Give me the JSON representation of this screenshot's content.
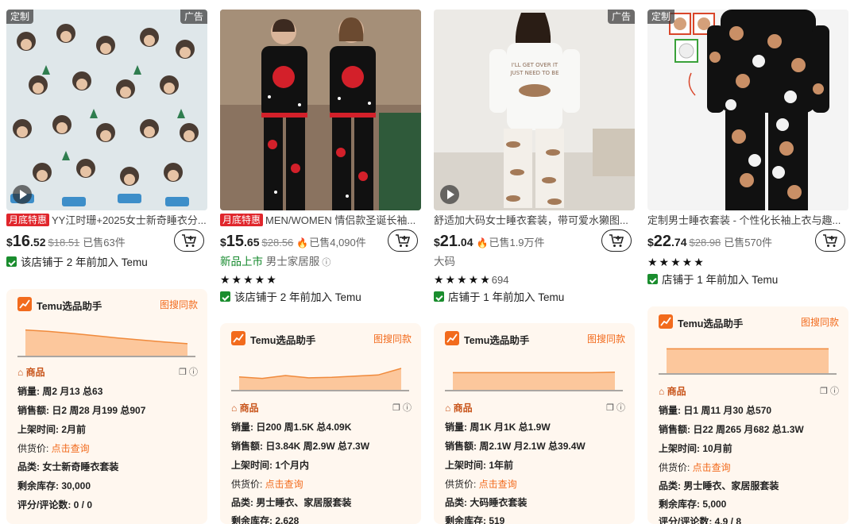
{
  "products": [
    {
      "badge_left": "定制",
      "badge_right": "广告",
      "video": true,
      "promo": "月底特惠",
      "title": "YY江时珊+2025女士新奇睡衣分...",
      "price_currency": "$",
      "price_int": "16",
      "price_cents": ".52",
      "orig_price": "$18.51",
      "hot": false,
      "sold": "已售63件",
      "new_tag": "",
      "category_tag": "",
      "size_tag": "",
      "stars": "",
      "rating_count": "",
      "store": "该店铺于 2 年前加入 Temu",
      "assistant": {
        "title": "Temu选品助手",
        "image_search": "图搜同款",
        "section": "商品",
        "sales": "销量: 周2 月13 总63",
        "revenue": "销售额: 日2 周28 月199 总907",
        "listed": "上架时间: 2月前",
        "supply_label": "供货价: ",
        "supply_link": "点击查询",
        "category": "品类: 女士新奇睡衣套装",
        "stock": "剩余库存: 30,000",
        "rating": "评分/评论数: 0 / 0",
        "trend": [
          0.9,
          0.85,
          0.78,
          0.7,
          0.62,
          0.55,
          0.48,
          0.42
        ]
      }
    },
    {
      "badge_left": "",
      "badge_right": "",
      "video": false,
      "promo": "月底特惠",
      "title": "MEN/WOMEN 情侣款圣诞长袖...",
      "price_currency": "$",
      "price_int": "15",
      "price_cents": ".65",
      "orig_price": "$28.56",
      "hot": true,
      "sold": "已售4,090件",
      "new_tag": "新品上市",
      "category_tag": "男士家居服",
      "size_tag": "",
      "stars": "★★★★★",
      "rating_count": "",
      "store": "该店铺于 2 年前加入 Temu",
      "assistant": {
        "title": "Temu选品助手",
        "image_search": "图搜同款",
        "section": "商品",
        "sales": "销量: 日200 周1.5K 总4.09K",
        "revenue": "销售额: 日3.84K 周2.9W 总7.3W",
        "listed": "上架时间: 1个月内",
        "supply_label": "供货价: ",
        "supply_link": "点击查询",
        "category": "品类: 男士睡衣、家居服套装",
        "stock": "剩余库存: 2,628",
        "rating": "",
        "trend": [
          0.45,
          0.4,
          0.5,
          0.42,
          0.44,
          0.48,
          0.52,
          0.75
        ]
      }
    },
    {
      "badge_left": "",
      "badge_right": "广告",
      "video": true,
      "promo": "",
      "title": "舒适加大码女士睡衣套装，带可爱水獭图...",
      "price_currency": "$",
      "price_int": "21",
      "price_cents": ".04",
      "orig_price": "",
      "hot": true,
      "sold": "已售1.9万件",
      "new_tag": "",
      "category_tag": "",
      "size_tag": "大码",
      "stars": "★★★★★",
      "rating_count": "694",
      "store": "店铺于 1 年前加入 Temu",
      "assistant": {
        "title": "Temu选品助手",
        "image_search": "图搜同款",
        "section": "商品",
        "sales": "销量: 周1K 月1K 总1.9W",
        "revenue": "销售额: 周2.1W 月2.1W 总39.4W",
        "listed": "上架时间: 1年前",
        "supply_label": "供货价: ",
        "supply_link": "点击查询",
        "category": "品类: 大码睡衣套装",
        "stock": "剩余库存: 519",
        "rating": "",
        "trend": [
          0.6,
          0.6,
          0.6,
          0.6,
          0.6,
          0.6,
          0.6,
          0.62
        ]
      }
    },
    {
      "badge_left": "定制",
      "badge_right": "",
      "video": false,
      "promo": "",
      "title": "定制男士睡衣套装 - 个性化长袖上衣与趣...",
      "price_currency": "$",
      "price_int": "22",
      "price_cents": ".74",
      "orig_price": "$28.98",
      "hot": false,
      "sold": "已售570件",
      "new_tag": "",
      "category_tag": "",
      "size_tag": "",
      "stars": "★★★★★",
      "rating_count": "",
      "store": "店铺于 1 年前加入 Temu",
      "assistant": {
        "title": "Temu选品助手",
        "image_search": "图搜同款",
        "section": "商品",
        "sales": "销量: 日1 周11 月30 总570",
        "revenue": "销售额: 日22 周265 月682 总1.3W",
        "listed": "上架时间: 10月前",
        "supply_label": "供货价: ",
        "supply_link": "点击查询",
        "category": "品类: 男士睡衣、家居服套装",
        "stock": "剩余库存: 5,000",
        "rating": "评分/评论数: 4.9 / 8",
        "trend": [
          0.85,
          0.85,
          0.85,
          0.85,
          0.85,
          0.85,
          0.85,
          0.85
        ]
      }
    }
  ],
  "colors": {
    "accent": "#f26b1d",
    "promo_red": "#e0262c",
    "store_green": "#1a8d2e",
    "panel_bg": "#fff7ef"
  },
  "icons": {
    "cart": "add-to-cart-icon",
    "store": "verified-store-icon",
    "logo": "chart-logo-icon",
    "section": "bag-icon",
    "copy": "copy-icon",
    "info": "info-icon",
    "play": "play-icon"
  }
}
